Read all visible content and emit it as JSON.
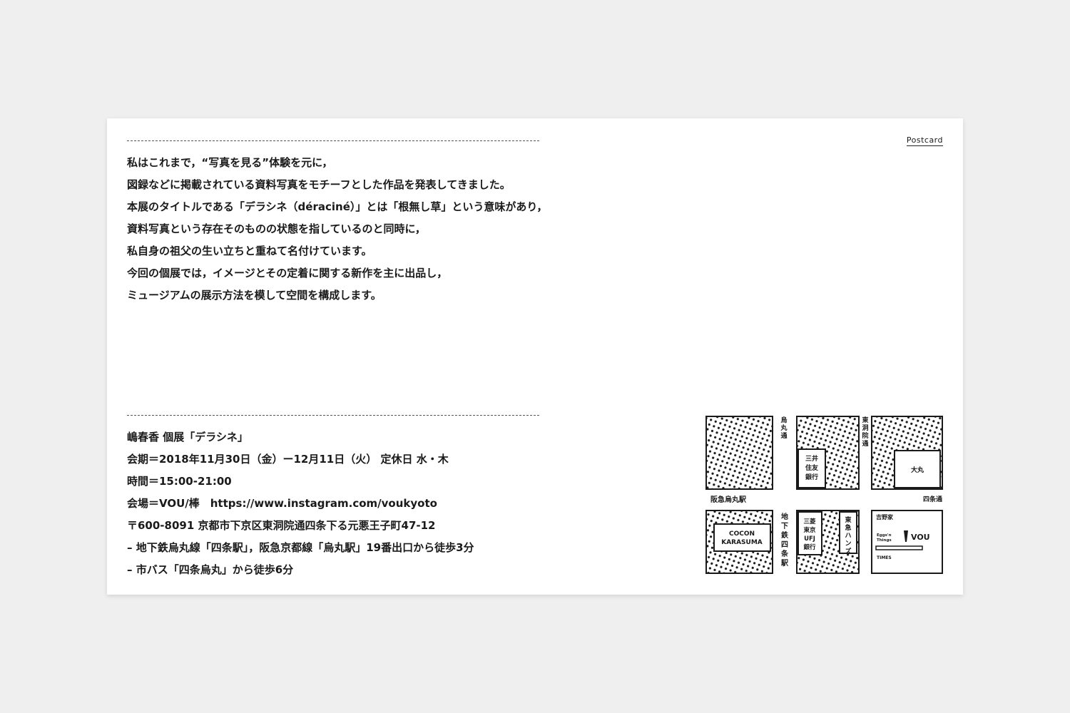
{
  "postcard_label": "Postcard",
  "statement": [
    "私はこれまで，“写真を見る”体験を元に，",
    "図録などに掲載されている資料写真をモチーフとした作品を発表してきました。",
    "本展のタイトルである「デラシネ（déraciné）」とは「根無し草」という意味があり，",
    "資料写真という存在そのものの状態を指しているのと同時に，",
    "私自身の祖父の生い立ちと重ねて名付けています。",
    "今回の個展では，イメージとその定着に関する新作を主に出品し，",
    "ミュージアムの展示方法を模して空間を構成します。"
  ],
  "info": [
    "嶋春香 個展「デラシネ」",
    "会期＝2018年11月30日（金）ー12月11日（火） 定休日 水・木",
    "時間＝15:00-21:00",
    "会場＝VOU/棒　https://www.instagram.com/voukyoto",
    "〒600-8091 京都市下京区東洞院通四条下る元悪王子町47-12",
    "– 地下鉄烏丸線「四条駅」，阪急京都線「烏丸駅」19番出口から徒歩3分",
    "– 市バス「四条烏丸」から徒歩6分"
  ],
  "map": {
    "karasuma_dori": "烏丸通",
    "higashinotoin_dori": "東洞院通",
    "shijo_dori": "四条通",
    "hankyu_karasuma_station": "阪急烏丸駅",
    "subway_shijo_station": "地下鉄四条駅",
    "mitsui_sumitomo_bank": "三井住友銀行",
    "daimaru": "大丸",
    "cocon_line1": "COCON",
    "cocon_line2": "KARASUMA",
    "mufg_bank": "三菱東京UFJ銀行",
    "tokyu_hands": "東急ハンズ",
    "yoshinoya": "吉野家",
    "eggs_line1": "Eggs'n",
    "eggs_line2": "Things",
    "vou": "VOU",
    "times": "TIMES",
    "accent_color": "#1a1a1a"
  }
}
